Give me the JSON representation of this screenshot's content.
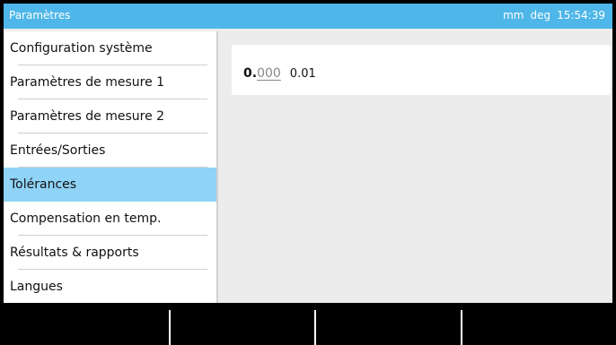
{
  "titlebar": {
    "title": "Paramètres",
    "unit1": "mm",
    "unit2": "deg",
    "time": "15:54:39"
  },
  "menu": {
    "items": [
      {
        "label": "Configuration système"
      },
      {
        "label": "Paramètres de mesure 1"
      },
      {
        "label": "Paramètres de mesure 2"
      },
      {
        "label": "Entrées/Sorties"
      },
      {
        "label": "Tolérances"
      },
      {
        "label": "Compensation en temp."
      },
      {
        "label": "Résultats & rapports"
      },
      {
        "label": "Langues"
      }
    ],
    "selected": "Tolérances"
  },
  "content": {
    "value_int": "0.",
    "value_dec": "000",
    "resolution": "0.01"
  },
  "colors": {
    "titlebar_bg": "#4eb6e8",
    "selected_bg": "#8fd3f6",
    "content_bg": "#ececec"
  }
}
